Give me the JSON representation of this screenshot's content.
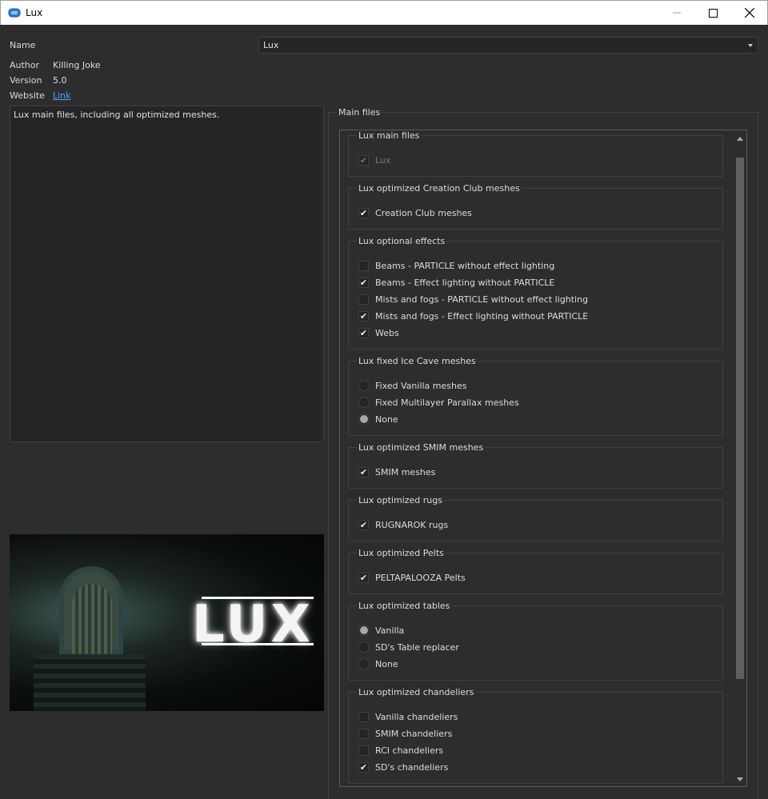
{
  "window": {
    "title": "Lux"
  },
  "info": {
    "name_label": "Name",
    "name_value": "Lux",
    "author_label": "Author",
    "author_value": "Killing Joke",
    "version_label": "Version",
    "version_value": "5.0",
    "website_label": "Website",
    "website_link": "Link",
    "description": "Lux main files, including all optimized meshes."
  },
  "preview": {
    "logo_text": "LUX"
  },
  "main_files": {
    "title": "Main files",
    "groups": [
      {
        "title": "Lux main files",
        "options": [
          {
            "label": "Lux",
            "type": "checkbox",
            "checked": true,
            "disabled": true
          }
        ]
      },
      {
        "title": "Lux optimized Creation Club meshes",
        "options": [
          {
            "label": "Creation Club meshes",
            "type": "checkbox",
            "checked": true
          }
        ]
      },
      {
        "title": "Lux optional effects",
        "options": [
          {
            "label": "Beams - PARTICLE without effect lighting",
            "type": "checkbox",
            "checked": false
          },
          {
            "label": "Beams - Effect lighting without PARTICLE",
            "type": "checkbox",
            "checked": true
          },
          {
            "label": "Mists and fogs - PARTICLE without effect lighting",
            "type": "checkbox",
            "checked": false
          },
          {
            "label": "Mists and fogs - Effect lighting without PARTICLE",
            "type": "checkbox",
            "checked": true
          },
          {
            "label": "Webs",
            "type": "checkbox",
            "checked": true
          }
        ]
      },
      {
        "title": "Lux fixed Ice Cave meshes",
        "options": [
          {
            "label": "Fixed Vanilla meshes",
            "type": "radio",
            "checked": false
          },
          {
            "label": "Fixed Multilayer Parallax meshes",
            "type": "radio",
            "checked": false
          },
          {
            "label": "None",
            "type": "radio",
            "checked": true
          }
        ]
      },
      {
        "title": "Lux optimized SMIM meshes",
        "options": [
          {
            "label": "SMIM meshes",
            "type": "checkbox",
            "checked": true
          }
        ]
      },
      {
        "title": "Lux optimized rugs",
        "options": [
          {
            "label": "RUGNAROK rugs",
            "type": "checkbox",
            "checked": true
          }
        ]
      },
      {
        "title": "Lux optimized Pelts",
        "options": [
          {
            "label": "PELTAPALOOZA Pelts",
            "type": "checkbox",
            "checked": true
          }
        ]
      },
      {
        "title": "Lux optimized tables",
        "options": [
          {
            "label": "Vanilla",
            "type": "radio",
            "checked": true
          },
          {
            "label": "SD's Table replacer",
            "type": "radio",
            "checked": false
          },
          {
            "label": "None",
            "type": "radio",
            "checked": false
          }
        ]
      },
      {
        "title": "Lux optimized chandeliers",
        "options": [
          {
            "label": "Vanilla chandeliers",
            "type": "checkbox",
            "checked": false
          },
          {
            "label": "SMIM chandeliers",
            "type": "checkbox",
            "checked": false
          },
          {
            "label": "RCI chandeliers",
            "type": "checkbox",
            "checked": false
          },
          {
            "label": "SD's chandeliers",
            "type": "checkbox",
            "checked": true
          }
        ]
      }
    ]
  },
  "colors": {
    "background": "#2d2d30",
    "field": "#252526",
    "border": "#3f3f46",
    "link": "#4aa3ff"
  }
}
